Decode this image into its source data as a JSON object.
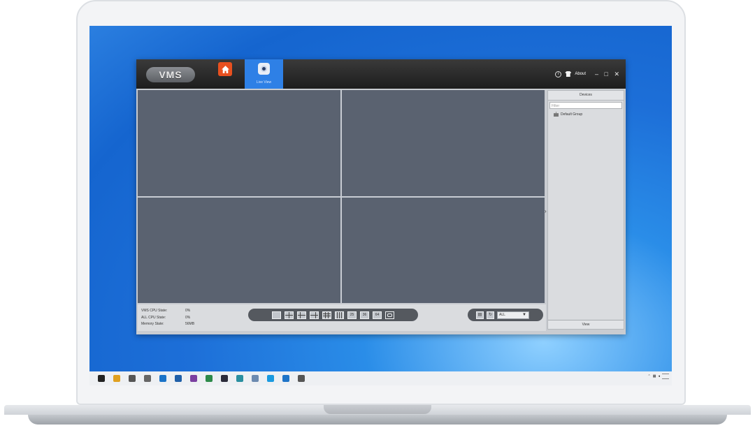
{
  "app": {
    "logo_text": "VMS",
    "home_icon": "home-icon",
    "live_tab_label": "Live View",
    "about_label": "About",
    "window_controls": "– □ ✕"
  },
  "devices": {
    "title": "Devices",
    "filter_placeholder": "Filter",
    "group_name": "Default Group",
    "view_button": "View"
  },
  "stats": [
    {
      "label": "VMS CPU State:",
      "value": "0%"
    },
    {
      "label": "ALL CPU State:",
      "value": "0%"
    },
    {
      "label": "Memory State:",
      "value": "56MB"
    }
  ],
  "layouts": {
    "labels": [
      "25",
      "36",
      "64"
    ]
  },
  "stream_select": {
    "value": "ALL",
    "arrow": "▼"
  },
  "taskbar": {
    "colors": [
      "#222222",
      "#e0a020",
      "#555555",
      "#666666",
      "#1a73c8",
      "#1f5fa8",
      "#7b3fa0",
      "#2d8a4a",
      "#2b2b3a",
      "#2a8fa0",
      "#6c8ab0",
      "#1a9ae0",
      "#1e74c8",
      "#555555"
    ]
  },
  "colors": {
    "accent": "#2e80e6",
    "home_button": "#e8501f",
    "video_cell": "#5a6270"
  }
}
